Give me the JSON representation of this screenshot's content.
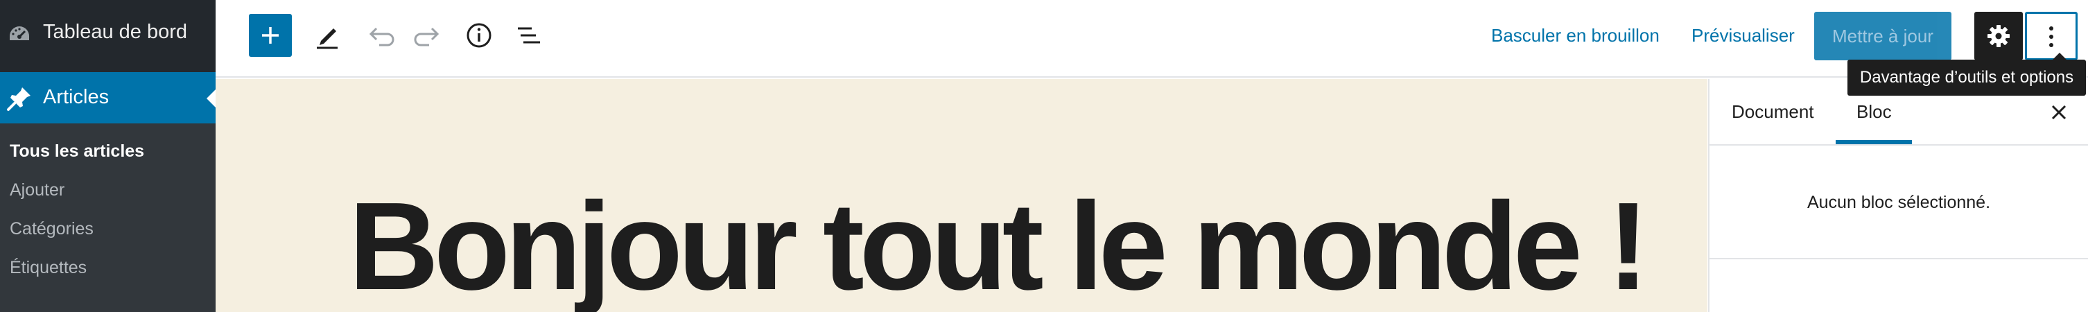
{
  "admin_menu": {
    "dashboard_label": "Tableau de bord",
    "articles_label": "Articles",
    "submenu": [
      {
        "label": "Tous les articles",
        "current": true
      },
      {
        "label": "Ajouter",
        "current": false
      },
      {
        "label": "Catégories",
        "current": false
      },
      {
        "label": "Étiquettes",
        "current": false
      }
    ]
  },
  "toolbar": {
    "add_block_icon": "plus-icon",
    "tools_icon": "pencil-icon",
    "undo_icon": "undo-icon",
    "redo_icon": "redo-icon",
    "info_icon": "info-icon",
    "outline_icon": "list-view-icon",
    "switch_to_draft": "Basculer en brouillon",
    "preview": "Prévisualiser",
    "update": "Mettre à jour",
    "settings_icon": "gear-icon",
    "more_icon": "more-vertical-icon"
  },
  "tooltip": "Davantage d’outils et options",
  "editor": {
    "post_title": "Bonjour tout le monde !"
  },
  "settings_sidebar": {
    "tabs": [
      "Document",
      "Bloc"
    ],
    "active_tab": "Bloc",
    "close_icon": "close-icon",
    "empty_message": "Aucun bloc sélectionné."
  },
  "colors": {
    "admin_bar": "#23282d",
    "accent": "#0073aa",
    "canvas_bg": "#f5efe0",
    "text_dark": "#1e1e1e"
  }
}
